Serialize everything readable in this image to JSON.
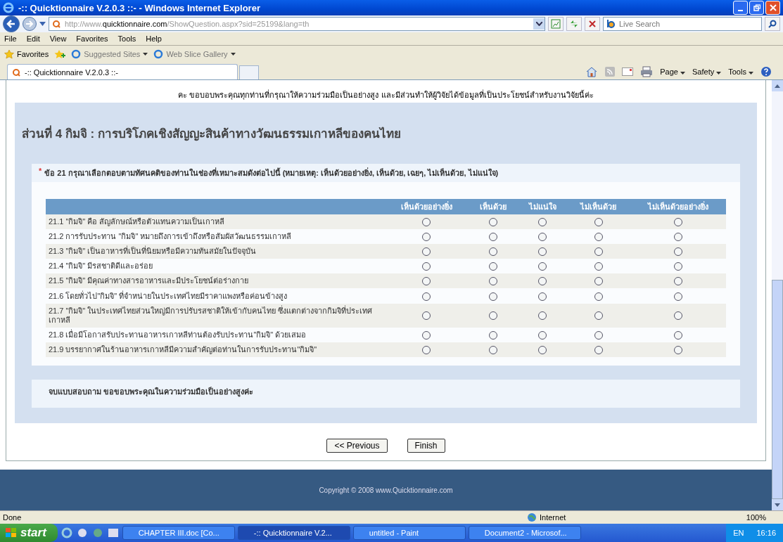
{
  "window": {
    "title": "-:: Quicktionnaire V.2.0.3 ::- - Windows Internet Explorer"
  },
  "address": {
    "prefix": "http://www.",
    "host": "quicktionnaire.com",
    "path": "/ShowQuestion.aspx?sid=25199&lang=th"
  },
  "search": {
    "placeholder": "Live Search"
  },
  "menu": [
    "File",
    "Edit",
    "View",
    "Favorites",
    "Tools",
    "Help"
  ],
  "favorites_bar": {
    "favorites": "Favorites",
    "links": [
      "Suggested Sites",
      "Web Slice Gallery"
    ]
  },
  "tabs": [
    {
      "label": "-:: Quicktionnaire V.2.0.3 ::-",
      "selected": true
    }
  ],
  "command_bar": [
    "Page",
    "Safety",
    "Tools"
  ],
  "page": {
    "intro": "คะ ขอบอบพระคุณทุกท่านที่กรุณาให้ความร่วมมือเป็นอย่างสูง และมีส่วนทำให้ผู้วิจัยได้ข้อมูลที่เป็นประโยชน์สำหรับงานวิจัยนี้ค่ะ",
    "section_title": "ส่วนที่ 4 กิมจิ : การบริโภคเชิงสัญญะสินค้าทางวัฒนธรรมเกาหลีของคนไทย",
    "question": {
      "mark": "*",
      "text": "ข้อ 21 กรุณาเลือกตอบตามทัศนคติของท่านในช่องที่เหมาะสมดังต่อไปนี้ (หมายเหตุ: เห็นด้วยอย่างยิ่ง, เห็นด้วย, เฉยๆ, ไม่เห็นด้วย, ไม่แน่ใจ)"
    },
    "columns": [
      "เห็นด้วยอย่างยิ่ง",
      "เห็นด้วย",
      "ไม่แน่ใจ",
      "ไม่เห็นด้วย",
      "ไม่เห็นด้วยอย่างยิ่ง"
    ],
    "rows": [
      {
        "label": "21.1 \"กิมจิ\" คือ สัญลักษณ์หรือตัวแทนความเป็นเกาหลี",
        "choices": [
          {
            "selected": false
          },
          {
            "selected": false
          },
          {
            "selected": false
          },
          {
            "selected": false
          },
          {
            "selected": false
          }
        ]
      },
      {
        "label": "21.2 การรับประทาน \"กิมจิ\" หมายถึงการเข้าถึงหรือสัมผัสวัฒนธรรมเกาหลี",
        "choices": [
          {
            "selected": false
          },
          {
            "selected": false
          },
          {
            "selected": false
          },
          {
            "selected": false
          },
          {
            "selected": false
          }
        ]
      },
      {
        "label": "21.3 \"กิมจิ\" เป็นอาหารที่เป็นที่นิยมหรือมีความทันสมัยในปัจจุบัน",
        "choices": [
          {
            "selected": false
          },
          {
            "selected": false
          },
          {
            "selected": false
          },
          {
            "selected": false
          },
          {
            "selected": false
          }
        ]
      },
      {
        "label": "21.4 \"กิมจิ\" มีรสชาติดีและอร่อย",
        "choices": [
          {
            "selected": false
          },
          {
            "selected": false
          },
          {
            "selected": false
          },
          {
            "selected": false
          },
          {
            "selected": false
          }
        ]
      },
      {
        "label": "21.5 \"กิมจิ\" มีคุณค่าทางสารอาหารและมีประโยชน์ต่อร่างกาย",
        "choices": [
          {
            "selected": false
          },
          {
            "selected": false
          },
          {
            "selected": false
          },
          {
            "selected": false
          },
          {
            "selected": false
          }
        ]
      },
      {
        "label": "21.6 โดยทั่วไป\"กิมจิ\" ที่จำหน่ายในประเทศไทยมีราคาแพงหรือค่อนข้างสูง",
        "choices": [
          {
            "selected": false
          },
          {
            "selected": false
          },
          {
            "selected": false
          },
          {
            "selected": false
          },
          {
            "selected": false
          }
        ]
      },
      {
        "label": "21.7 \"กิมจิ\" ในประเทศไทยส่วนใหญ่มีการปรับรสชาติให้เข้ากับคนไทย ซึ่งแตกต่างจากกิมจิที่ประเทศเกาหลี",
        "choices": [
          {
            "selected": false
          },
          {
            "selected": false
          },
          {
            "selected": false
          },
          {
            "selected": false
          },
          {
            "selected": false
          }
        ]
      },
      {
        "label": "21.8 เมื่อมีโอกาสรับประทานอาหารเกาหลีท่านต้องรับประทาน\"กิมจิ\" ด้วยเสมอ",
        "choices": [
          {
            "selected": false
          },
          {
            "selected": false
          },
          {
            "selected": false
          },
          {
            "selected": false
          },
          {
            "selected": false
          }
        ]
      },
      {
        "label": "21.9 บรรยากาศในร้านอาหารเกาหลีมีความสำคัญต่อท่านในการรับประทาน\"กิมจิ\"",
        "choices": [
          {
            "selected": false
          },
          {
            "selected": false
          },
          {
            "selected": false
          },
          {
            "selected": false
          },
          {
            "selected": false
          }
        ]
      }
    ],
    "closing": "จบแบบสอบถาม ขอขอบพระคุณในความร่วมมือเป็นอย่างสูงค่ะ",
    "buttons": [
      "<< Previous",
      "Finish"
    ],
    "footer": "Copyright © 2008   www.Quicktionnaire.com"
  },
  "status_bar": {
    "text": "Done",
    "zone": "Internet",
    "zoom": "100%"
  },
  "taskbar": {
    "start": "start",
    "tasks": [
      {
        "label": "CHAPTER III.doc [Co...",
        "selected": false
      },
      {
        "label": "-:: Quicktionnaire V.2...",
        "selected": true
      },
      {
        "label": "untitled - Paint",
        "selected": false
      },
      {
        "label": "Document2 - Microsof...",
        "selected": false
      }
    ],
    "language": "EN",
    "clock": "16:16"
  }
}
